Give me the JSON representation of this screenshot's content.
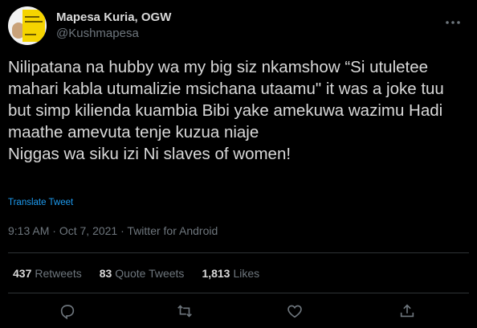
{
  "user": {
    "display_name": "Mapesa Kuria, OGW",
    "handle": "@Kushmapesa"
  },
  "tweet": {
    "text": "Nilipatana na hubby wa my big siz nkamshow “Si utuletee mahari kabla utumalizie msichana utaamu\" it was a joke tuu but simp kilienda kuambia Bibi yake amekuwa wazimu Hadi maathe amevuta tenje kuzua niaje\nNiggas wa siku izi Ni slaves of women!",
    "translate_label": "Translate Tweet",
    "time": "9:13 AM",
    "date": "Oct 7, 2021",
    "source": "Twitter for Android",
    "separator": "·"
  },
  "stats": {
    "retweets_count": "437",
    "retweets_label": "Retweets",
    "quotes_count": "83",
    "quotes_label": "Quote Tweets",
    "likes_count": "1,813",
    "likes_label": "Likes"
  },
  "icons": {
    "more": "more-icon",
    "reply": "reply-icon",
    "retweet": "retweet-icon",
    "like": "like-icon",
    "share": "share-icon"
  },
  "colors": {
    "background": "#000000",
    "text": "#d9d9d9",
    "muted": "#6e767d",
    "accent": "#1d9bf0",
    "divider": "#2f3336"
  }
}
